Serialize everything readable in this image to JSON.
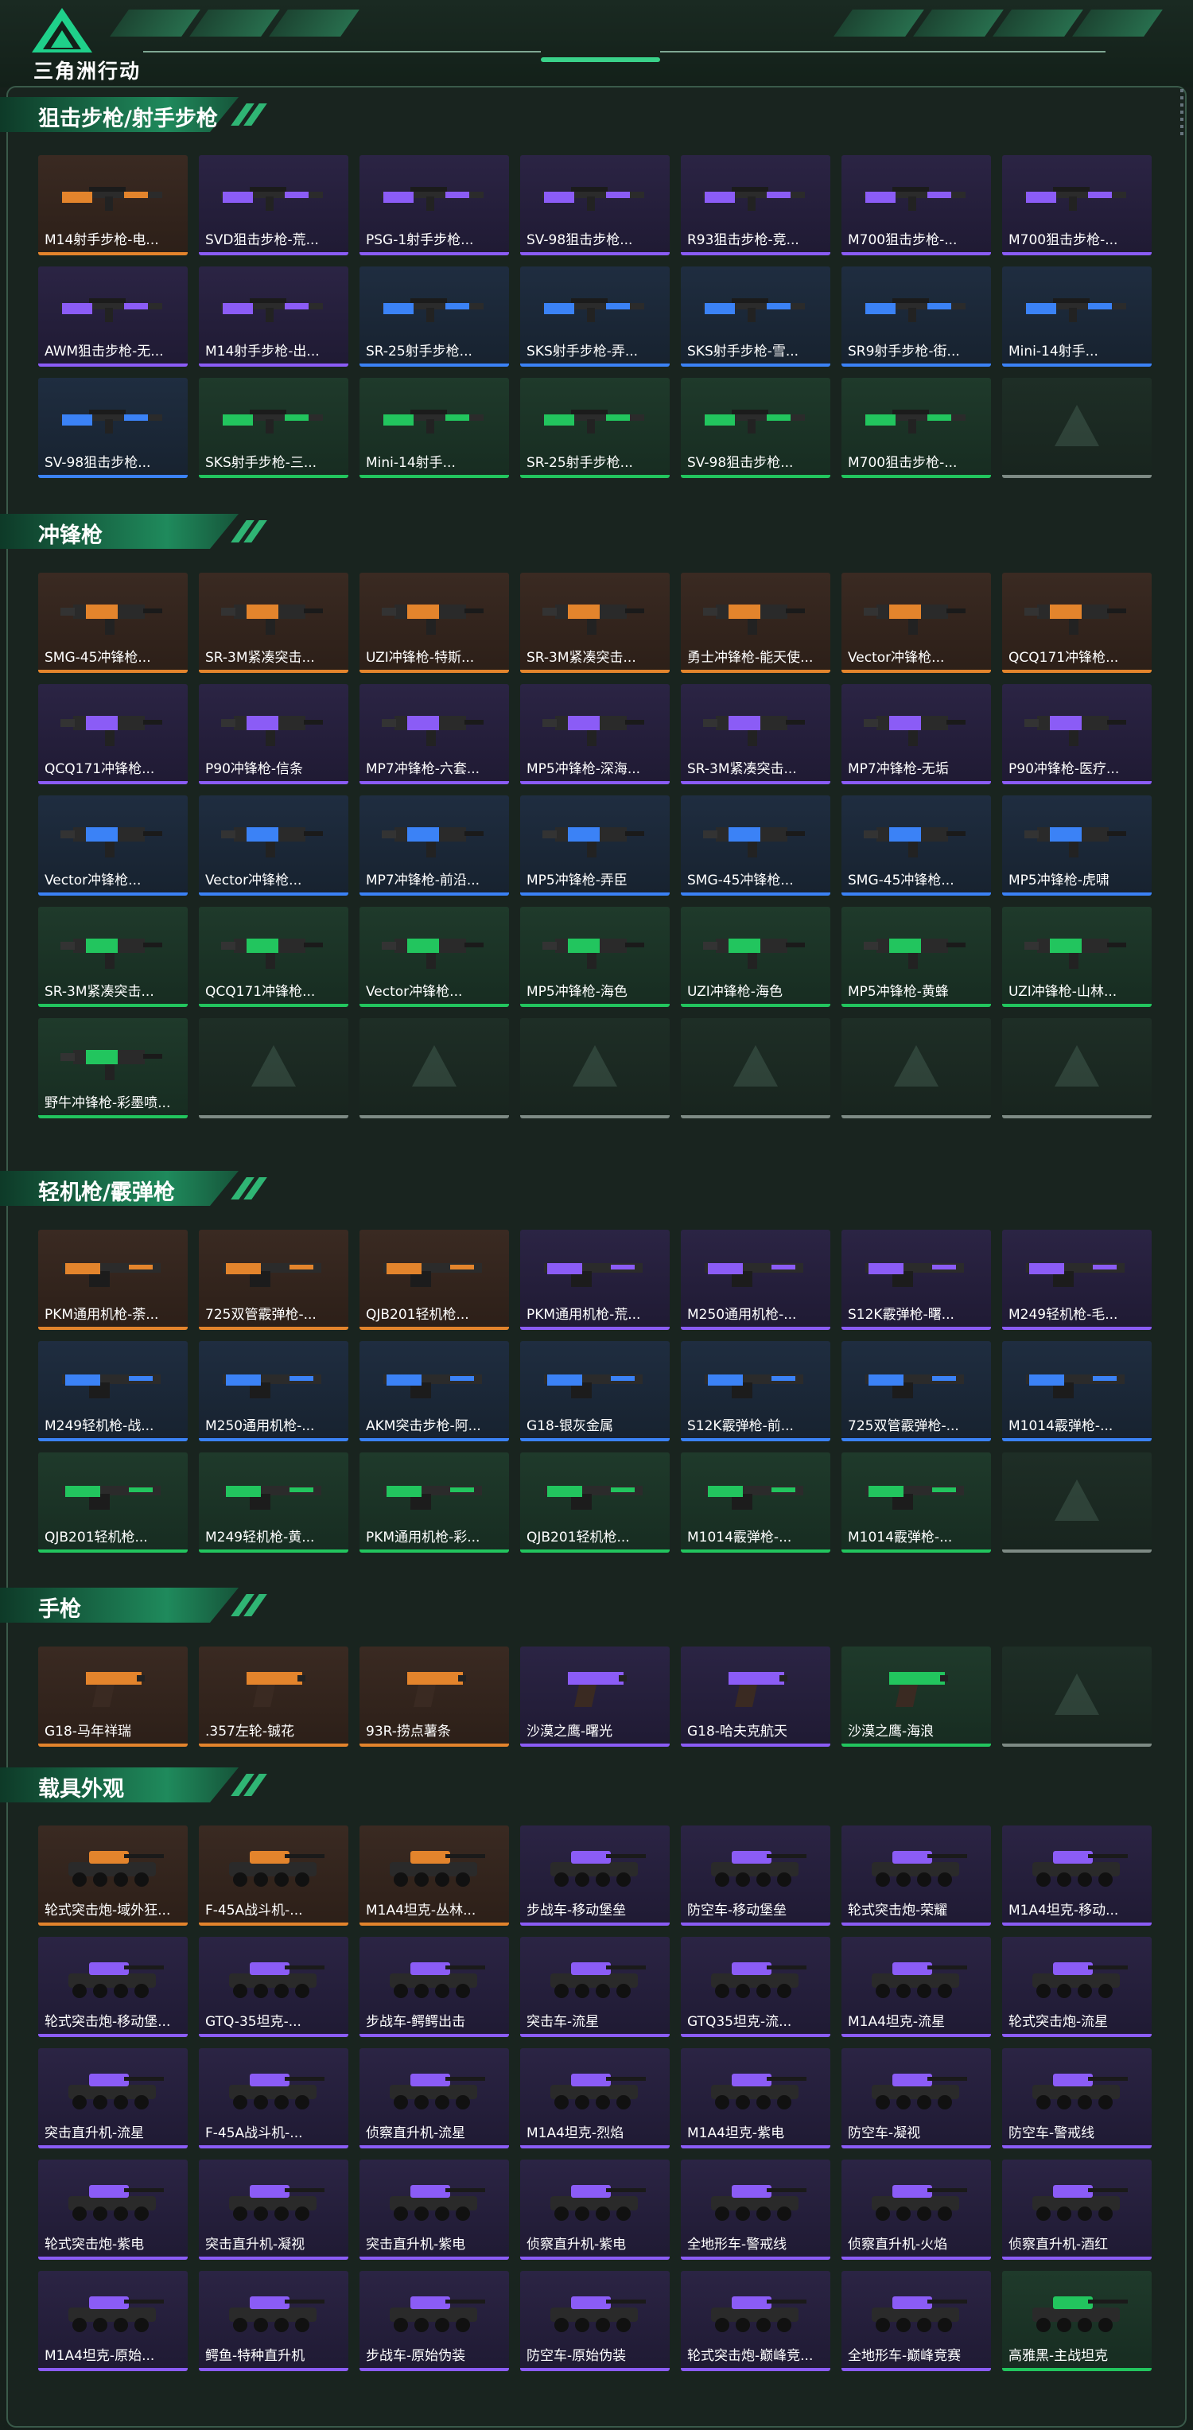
{
  "header": {
    "logo_text": "三角洲行动",
    "logo_icon": "delta-triangle-logo-icon"
  },
  "colors": {
    "orange": "#e3842c",
    "purple": "#8b5cf6",
    "blue": "#3b82f6",
    "green": "#22c55e",
    "white": "#d9dde0",
    "accent": "#1f8a5c"
  },
  "sections": [
    {
      "title": "狙击步枪/射手步枪",
      "items": [
        {
          "label": "M14射手步枪-电...",
          "rarity": "orange",
          "kind": "rifle"
        },
        {
          "label": "SVD狙击步枪-荒...",
          "rarity": "purple",
          "kind": "rifle"
        },
        {
          "label": "PSG-1射手步枪...",
          "rarity": "purple",
          "kind": "rifle"
        },
        {
          "label": "SV-98狙击步枪...",
          "rarity": "purple",
          "kind": "rifle"
        },
        {
          "label": "R93狙击步枪-竞...",
          "rarity": "purple",
          "kind": "rifle"
        },
        {
          "label": "M700狙击步枪-...",
          "rarity": "purple",
          "kind": "rifle"
        },
        {
          "label": "M700狙击步枪-...",
          "rarity": "purple",
          "kind": "rifle"
        },
        {
          "label": "AWM狙击步枪-无...",
          "rarity": "purple",
          "kind": "rifle"
        },
        {
          "label": "M14射手步枪-出...",
          "rarity": "purple",
          "kind": "rifle"
        },
        {
          "label": "SR-25射手步枪...",
          "rarity": "blue",
          "kind": "rifle"
        },
        {
          "label": "SKS射手步枪-弄...",
          "rarity": "blue",
          "kind": "rifle"
        },
        {
          "label": "SKS射手步枪-雪...",
          "rarity": "blue",
          "kind": "rifle"
        },
        {
          "label": "SR9射手步枪-街...",
          "rarity": "blue",
          "kind": "rifle"
        },
        {
          "label": "Mini-14射手...",
          "rarity": "blue",
          "kind": "rifle"
        },
        {
          "label": "SV-98狙击步枪...",
          "rarity": "blue",
          "kind": "rifle"
        },
        {
          "label": "SKS射手步枪-三...",
          "rarity": "green",
          "kind": "rifle"
        },
        {
          "label": "Mini-14射手...",
          "rarity": "green",
          "kind": "rifle"
        },
        {
          "label": "SR-25射手步枪...",
          "rarity": "green",
          "kind": "rifle"
        },
        {
          "label": "SV-98狙击步枪...",
          "rarity": "green",
          "kind": "rifle"
        },
        {
          "label": "M700狙击步枪-...",
          "rarity": "green",
          "kind": "rifle"
        },
        {
          "label": "",
          "rarity": "empty",
          "kind": "empty"
        }
      ]
    },
    {
      "title": "冲锋枪",
      "items": [
        {
          "label": "SMG-45冲锋枪...",
          "rarity": "orange",
          "kind": "smg"
        },
        {
          "label": "SR-3M紧凑突击...",
          "rarity": "orange",
          "kind": "smg"
        },
        {
          "label": "UZI冲锋枪-特斯...",
          "rarity": "orange",
          "kind": "smg"
        },
        {
          "label": "SR-3M紧凑突击...",
          "rarity": "orange",
          "kind": "smg"
        },
        {
          "label": "勇士冲锋枪-能天使...",
          "rarity": "orange",
          "kind": "smg"
        },
        {
          "label": "Vector冲锋枪...",
          "rarity": "orange",
          "kind": "smg"
        },
        {
          "label": "QCQ171冲锋枪...",
          "rarity": "orange",
          "kind": "smg"
        },
        {
          "label": "QCQ171冲锋枪...",
          "rarity": "purple",
          "kind": "smg"
        },
        {
          "label": "P90冲锋枪-信条",
          "rarity": "purple",
          "kind": "smg"
        },
        {
          "label": "MP7冲锋枪-六套...",
          "rarity": "purple",
          "kind": "smg"
        },
        {
          "label": "MP5冲锋枪-深海...",
          "rarity": "purple",
          "kind": "smg"
        },
        {
          "label": "SR-3M紧凑突击...",
          "rarity": "purple",
          "kind": "smg"
        },
        {
          "label": "MP7冲锋枪-无垢",
          "rarity": "purple",
          "kind": "smg"
        },
        {
          "label": "P90冲锋枪-医疗...",
          "rarity": "purple",
          "kind": "smg"
        },
        {
          "label": "Vector冲锋枪...",
          "rarity": "blue",
          "kind": "smg"
        },
        {
          "label": "Vector冲锋枪...",
          "rarity": "blue",
          "kind": "smg"
        },
        {
          "label": "MP7冲锋枪-前沿...",
          "rarity": "blue",
          "kind": "smg"
        },
        {
          "label": "MP5冲锋枪-弄臣",
          "rarity": "blue",
          "kind": "smg"
        },
        {
          "label": "SMG-45冲锋枪...",
          "rarity": "blue",
          "kind": "smg"
        },
        {
          "label": "SMG-45冲锋枪...",
          "rarity": "blue",
          "kind": "smg"
        },
        {
          "label": "MP5冲锋枪-虎啸",
          "rarity": "blue",
          "kind": "smg"
        },
        {
          "label": "SR-3M紧凑突击...",
          "rarity": "green",
          "kind": "smg"
        },
        {
          "label": "QCQ171冲锋枪...",
          "rarity": "green",
          "kind": "smg"
        },
        {
          "label": "Vector冲锋枪...",
          "rarity": "green",
          "kind": "smg"
        },
        {
          "label": "MP5冲锋枪-海色",
          "rarity": "green",
          "kind": "smg"
        },
        {
          "label": "UZI冲锋枪-海色",
          "rarity": "green",
          "kind": "smg"
        },
        {
          "label": "MP5冲锋枪-黄蜂",
          "rarity": "green",
          "kind": "smg"
        },
        {
          "label": "UZI冲锋枪-山林...",
          "rarity": "green",
          "kind": "smg"
        },
        {
          "label": "野牛冲锋枪-彩墨喷...",
          "rarity": "green",
          "kind": "smg"
        },
        {
          "label": "",
          "rarity": "empty",
          "kind": "empty"
        },
        {
          "label": "",
          "rarity": "empty",
          "kind": "empty"
        },
        {
          "label": "",
          "rarity": "empty",
          "kind": "empty"
        },
        {
          "label": "",
          "rarity": "empty",
          "kind": "empty"
        },
        {
          "label": "",
          "rarity": "empty",
          "kind": "empty"
        },
        {
          "label": "",
          "rarity": "empty",
          "kind": "empty"
        }
      ]
    },
    {
      "title": "轻机枪/霰弹枪",
      "items": [
        {
          "label": "PKM通用机枪-荼...",
          "rarity": "orange",
          "kind": "mg"
        },
        {
          "label": "725双管霰弹枪-...",
          "rarity": "orange",
          "kind": "mg"
        },
        {
          "label": "QJB201轻机枪...",
          "rarity": "orange",
          "kind": "mg"
        },
        {
          "label": "PKM通用机枪-荒...",
          "rarity": "purple",
          "kind": "mg"
        },
        {
          "label": "M250通用机枪-...",
          "rarity": "purple",
          "kind": "mg"
        },
        {
          "label": "S12K霰弹枪-曙...",
          "rarity": "purple",
          "kind": "mg"
        },
        {
          "label": "M249轻机枪-毛...",
          "rarity": "purple",
          "kind": "mg"
        },
        {
          "label": "M249轻机枪-战...",
          "rarity": "blue",
          "kind": "mg"
        },
        {
          "label": "M250通用机枪-...",
          "rarity": "blue",
          "kind": "mg"
        },
        {
          "label": "AKM突击步枪-阿...",
          "rarity": "blue",
          "kind": "mg"
        },
        {
          "label": "G18-银灰金属",
          "rarity": "blue",
          "kind": "mg"
        },
        {
          "label": "S12K霰弹枪-前...",
          "rarity": "blue",
          "kind": "mg"
        },
        {
          "label": "725双管霰弹枪-...",
          "rarity": "blue",
          "kind": "mg"
        },
        {
          "label": "M1014霰弹枪-...",
          "rarity": "blue",
          "kind": "mg"
        },
        {
          "label": "QJB201轻机枪...",
          "rarity": "green",
          "kind": "mg"
        },
        {
          "label": "M249轻机枪-黄...",
          "rarity": "green",
          "kind": "mg"
        },
        {
          "label": "PKM通用机枪-彩...",
          "rarity": "green",
          "kind": "mg"
        },
        {
          "label": "QJB201轻机枪...",
          "rarity": "green",
          "kind": "mg"
        },
        {
          "label": "M1014霰弹枪-...",
          "rarity": "green",
          "kind": "mg"
        },
        {
          "label": "M1014霰弹枪-...",
          "rarity": "green",
          "kind": "mg"
        },
        {
          "label": "",
          "rarity": "empty",
          "kind": "empty"
        }
      ]
    },
    {
      "title": "手枪",
      "items": [
        {
          "label": "G18-马年祥瑞",
          "rarity": "orange",
          "kind": "pistol"
        },
        {
          "label": ".357左轮-铖花",
          "rarity": "orange",
          "kind": "pistol"
        },
        {
          "label": "93R-捞点薯条",
          "rarity": "orange",
          "kind": "pistol"
        },
        {
          "label": "沙漠之鹰-曙光",
          "rarity": "purple",
          "kind": "pistol"
        },
        {
          "label": "G18-哈夫克航天",
          "rarity": "purple",
          "kind": "pistol"
        },
        {
          "label": "沙漠之鹰-海浪",
          "rarity": "green",
          "kind": "pistol"
        },
        {
          "label": "",
          "rarity": "empty",
          "kind": "empty"
        }
      ]
    },
    {
      "title": "载具外观",
      "items": [
        {
          "label": "轮式突击炮-域外狂...",
          "rarity": "orange",
          "kind": "vehicle"
        },
        {
          "label": "F-45A战斗机-...",
          "rarity": "orange",
          "kind": "vehicle"
        },
        {
          "label": "M1A4坦克-丛林...",
          "rarity": "orange",
          "kind": "vehicle"
        },
        {
          "label": "步战车-移动堡垒",
          "rarity": "purple",
          "kind": "vehicle"
        },
        {
          "label": "防空车-移动堡垒",
          "rarity": "purple",
          "kind": "vehicle"
        },
        {
          "label": "轮式突击炮-荣耀",
          "rarity": "purple",
          "kind": "vehicle"
        },
        {
          "label": "M1A4坦克-移动...",
          "rarity": "purple",
          "kind": "vehicle"
        },
        {
          "label": "轮式突击炮-移动堡...",
          "rarity": "purple",
          "kind": "vehicle"
        },
        {
          "label": "GTQ-35坦克-...",
          "rarity": "purple",
          "kind": "vehicle"
        },
        {
          "label": "步战车-鳄鳄出击",
          "rarity": "purple",
          "kind": "vehicle"
        },
        {
          "label": "突击车-流星",
          "rarity": "purple",
          "kind": "vehicle"
        },
        {
          "label": "GTQ35坦克-流...",
          "rarity": "purple",
          "kind": "vehicle"
        },
        {
          "label": "M1A4坦克-流星",
          "rarity": "purple",
          "kind": "vehicle"
        },
        {
          "label": "轮式突击炮-流星",
          "rarity": "purple",
          "kind": "vehicle"
        },
        {
          "label": "突击直升机-流星",
          "rarity": "purple",
          "kind": "vehicle"
        },
        {
          "label": "F-45A战斗机-...",
          "rarity": "purple",
          "kind": "vehicle"
        },
        {
          "label": "侦察直升机-流星",
          "rarity": "purple",
          "kind": "vehicle"
        },
        {
          "label": "M1A4坦克-烈焰",
          "rarity": "purple",
          "kind": "vehicle"
        },
        {
          "label": "M1A4坦克-紫电",
          "rarity": "purple",
          "kind": "vehicle"
        },
        {
          "label": "防空车-凝视",
          "rarity": "purple",
          "kind": "vehicle"
        },
        {
          "label": "防空车-警戒线",
          "rarity": "purple",
          "kind": "vehicle"
        },
        {
          "label": "轮式突击炮-紫电",
          "rarity": "purple",
          "kind": "vehicle"
        },
        {
          "label": "突击直升机-凝视",
          "rarity": "purple",
          "kind": "vehicle"
        },
        {
          "label": "突击直升机-紫电",
          "rarity": "purple",
          "kind": "vehicle"
        },
        {
          "label": "侦察直升机-紫电",
          "rarity": "purple",
          "kind": "vehicle"
        },
        {
          "label": "全地形车-警戒线",
          "rarity": "purple",
          "kind": "vehicle"
        },
        {
          "label": "侦察直升机-火焰",
          "rarity": "purple",
          "kind": "vehicle"
        },
        {
          "label": "侦察直升机-酒红",
          "rarity": "purple",
          "kind": "vehicle"
        },
        {
          "label": "M1A4坦克-原始...",
          "rarity": "purple",
          "kind": "vehicle"
        },
        {
          "label": "鳄鱼-特种直升机",
          "rarity": "purple",
          "kind": "vehicle"
        },
        {
          "label": "步战车-原始伪装",
          "rarity": "purple",
          "kind": "vehicle"
        },
        {
          "label": "防空车-原始伪装",
          "rarity": "purple",
          "kind": "vehicle"
        },
        {
          "label": "轮式突击炮-巅峰竞...",
          "rarity": "purple",
          "kind": "vehicle"
        },
        {
          "label": "全地形车-巅峰竞赛",
          "rarity": "purple",
          "kind": "vehicle"
        },
        {
          "label": "高雅黑-主战坦克",
          "rarity": "green",
          "kind": "vehicle"
        }
      ]
    }
  ]
}
